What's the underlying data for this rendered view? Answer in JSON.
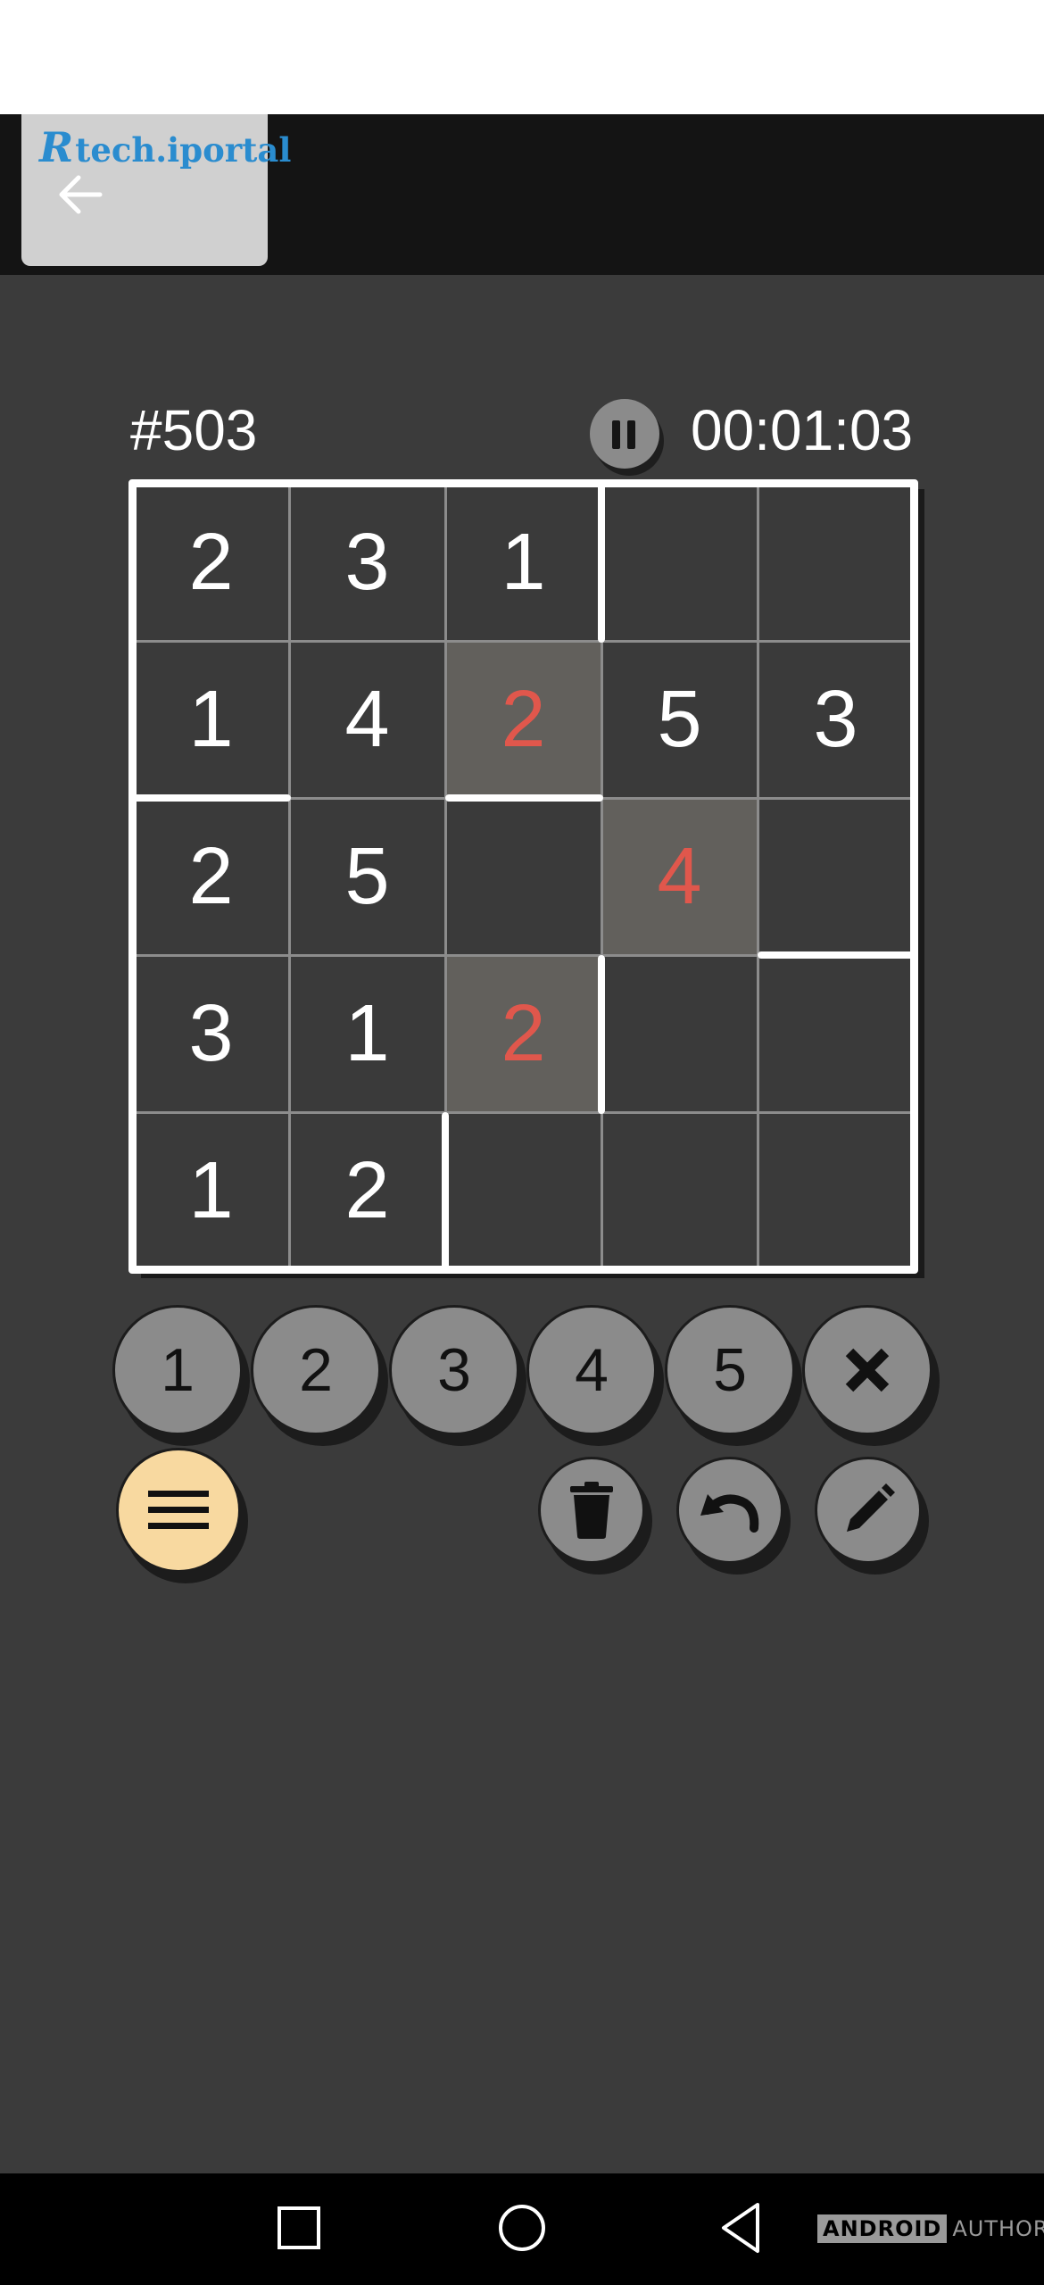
{
  "watermark": {
    "brand": "tech.iportal",
    "mark": "R"
  },
  "header": {
    "back_icon": "arrow-left-icon"
  },
  "game": {
    "puzzle_id": "#503",
    "timer": "00:01:03",
    "pause_icon": "pause-icon",
    "board_size": 5,
    "cells": [
      [
        {
          "v": "2",
          "color": "white",
          "hl": false
        },
        {
          "v": "3",
          "color": "white",
          "hl": false
        },
        {
          "v": "1",
          "color": "white",
          "hl": false
        },
        {
          "v": "",
          "color": "white",
          "hl": false
        },
        {
          "v": "",
          "color": "white",
          "hl": false
        }
      ],
      [
        {
          "v": "1",
          "color": "white",
          "hl": false
        },
        {
          "v": "4",
          "color": "white",
          "hl": false
        },
        {
          "v": "2",
          "color": "red",
          "hl": true
        },
        {
          "v": "5",
          "color": "white",
          "hl": false
        },
        {
          "v": "3",
          "color": "white",
          "hl": false
        }
      ],
      [
        {
          "v": "2",
          "color": "white",
          "hl": false
        },
        {
          "v": "5",
          "color": "white",
          "hl": false
        },
        {
          "v": "",
          "color": "white",
          "hl": false
        },
        {
          "v": "4",
          "color": "red",
          "hl": true
        },
        {
          "v": "",
          "color": "white",
          "hl": false
        }
      ],
      [
        {
          "v": "3",
          "color": "white",
          "hl": false
        },
        {
          "v": "1",
          "color": "white",
          "hl": false
        },
        {
          "v": "2",
          "color": "red",
          "hl": true
        },
        {
          "v": "",
          "color": "white",
          "hl": false
        },
        {
          "v": "",
          "color": "white",
          "hl": false
        }
      ],
      [
        {
          "v": "1",
          "color": "white",
          "hl": false
        },
        {
          "v": "2",
          "color": "white",
          "hl": false
        },
        {
          "v": "",
          "color": "white",
          "hl": false
        },
        {
          "v": "",
          "color": "white",
          "hl": false
        },
        {
          "v": "",
          "color": "white",
          "hl": false
        }
      ]
    ]
  },
  "numpad": {
    "digits": [
      "1",
      "2",
      "3",
      "4",
      "5"
    ],
    "clear_icon": "close-x-icon"
  },
  "actions": {
    "menu_icon": "hamburger-menu-icon",
    "delete_icon": "trash-icon",
    "undo_icon": "undo-icon",
    "edit_icon": "pencil-icon"
  },
  "navbar": {
    "recents_icon": "square-recents-icon",
    "home_icon": "circle-home-icon",
    "back_icon": "triangle-back-icon"
  },
  "branding": {
    "box_text": "ANDROID",
    "text": "AUTHORITY"
  },
  "colors": {
    "error": "#e0574c",
    "highlight": "#62605c",
    "menu_button": "#f8d9a0",
    "background": "#3b3b3b"
  }
}
